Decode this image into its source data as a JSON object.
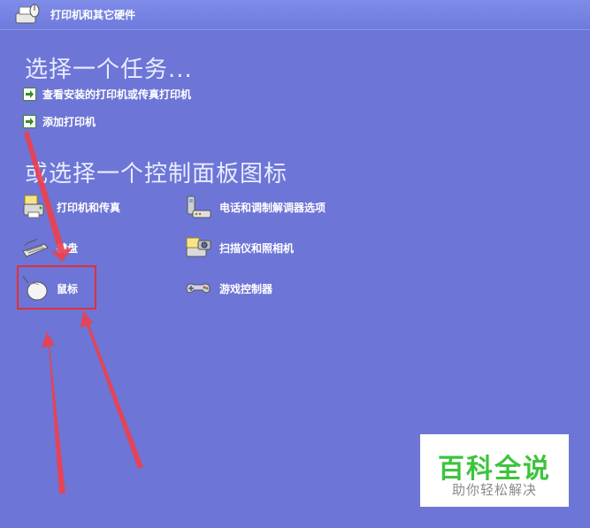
{
  "window": {
    "title": "打印机和其它硬件"
  },
  "tasks": {
    "heading": "选择一个任务...",
    "items": [
      {
        "label": "查看安装的打印机或传真打印机"
      },
      {
        "label": "添加打印机"
      }
    ]
  },
  "panel": {
    "heading": "或选择一个控制面板图标",
    "items": [
      {
        "label": "打印机和传真",
        "icon": "printer-fax-icon"
      },
      {
        "label": "电话和调制解调器选项",
        "icon": "phone-modem-icon"
      },
      {
        "label": "键盘",
        "icon": "keyboard-icon"
      },
      {
        "label": "扫描仪和照相机",
        "icon": "scanner-camera-icon"
      },
      {
        "label": "鼠标",
        "icon": "mouse-icon"
      },
      {
        "label": "游戏控制器",
        "icon": "gamepad-icon"
      }
    ]
  },
  "colors": {
    "background": "#6d75d6",
    "highlight": "#e0303a",
    "task_arrow_green": "#3b8a2e"
  },
  "watermark": {
    "main": "百科全说",
    "sub": "助你轻松解决"
  }
}
